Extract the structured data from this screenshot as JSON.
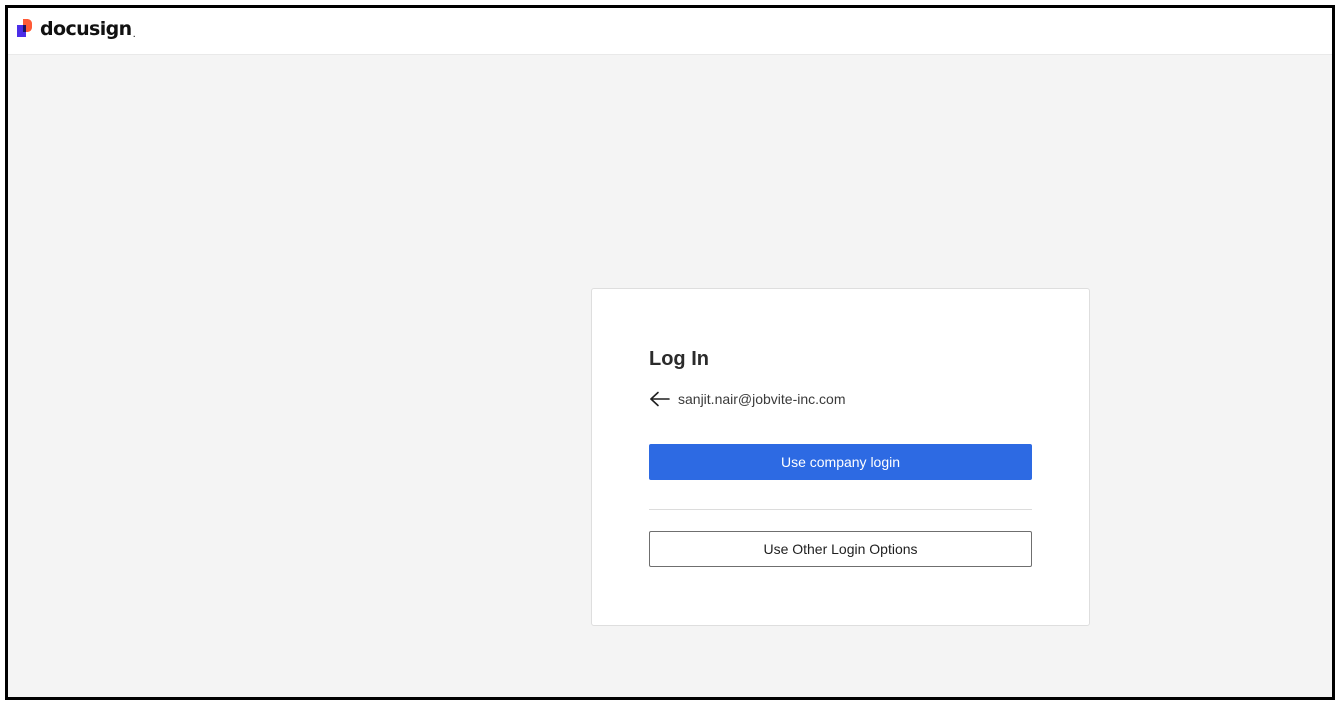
{
  "brand": {
    "name": "docusign",
    "dot": ".",
    "colors": {
      "logo_red": "#ff5a36",
      "logo_purple": "#4c2ee8",
      "logo_dark": "#1b1464"
    }
  },
  "login_card": {
    "title": "Log In",
    "email": "sanjit.nair@jobvite-inc.com",
    "back_icon": "arrow-left-icon",
    "primary_button": "Use company login",
    "secondary_button": "Use Other Login Options"
  },
  "colors": {
    "background": "#f4f4f4",
    "card": "#ffffff",
    "primary": "#2d6ae3",
    "frame_border": "#000000"
  }
}
